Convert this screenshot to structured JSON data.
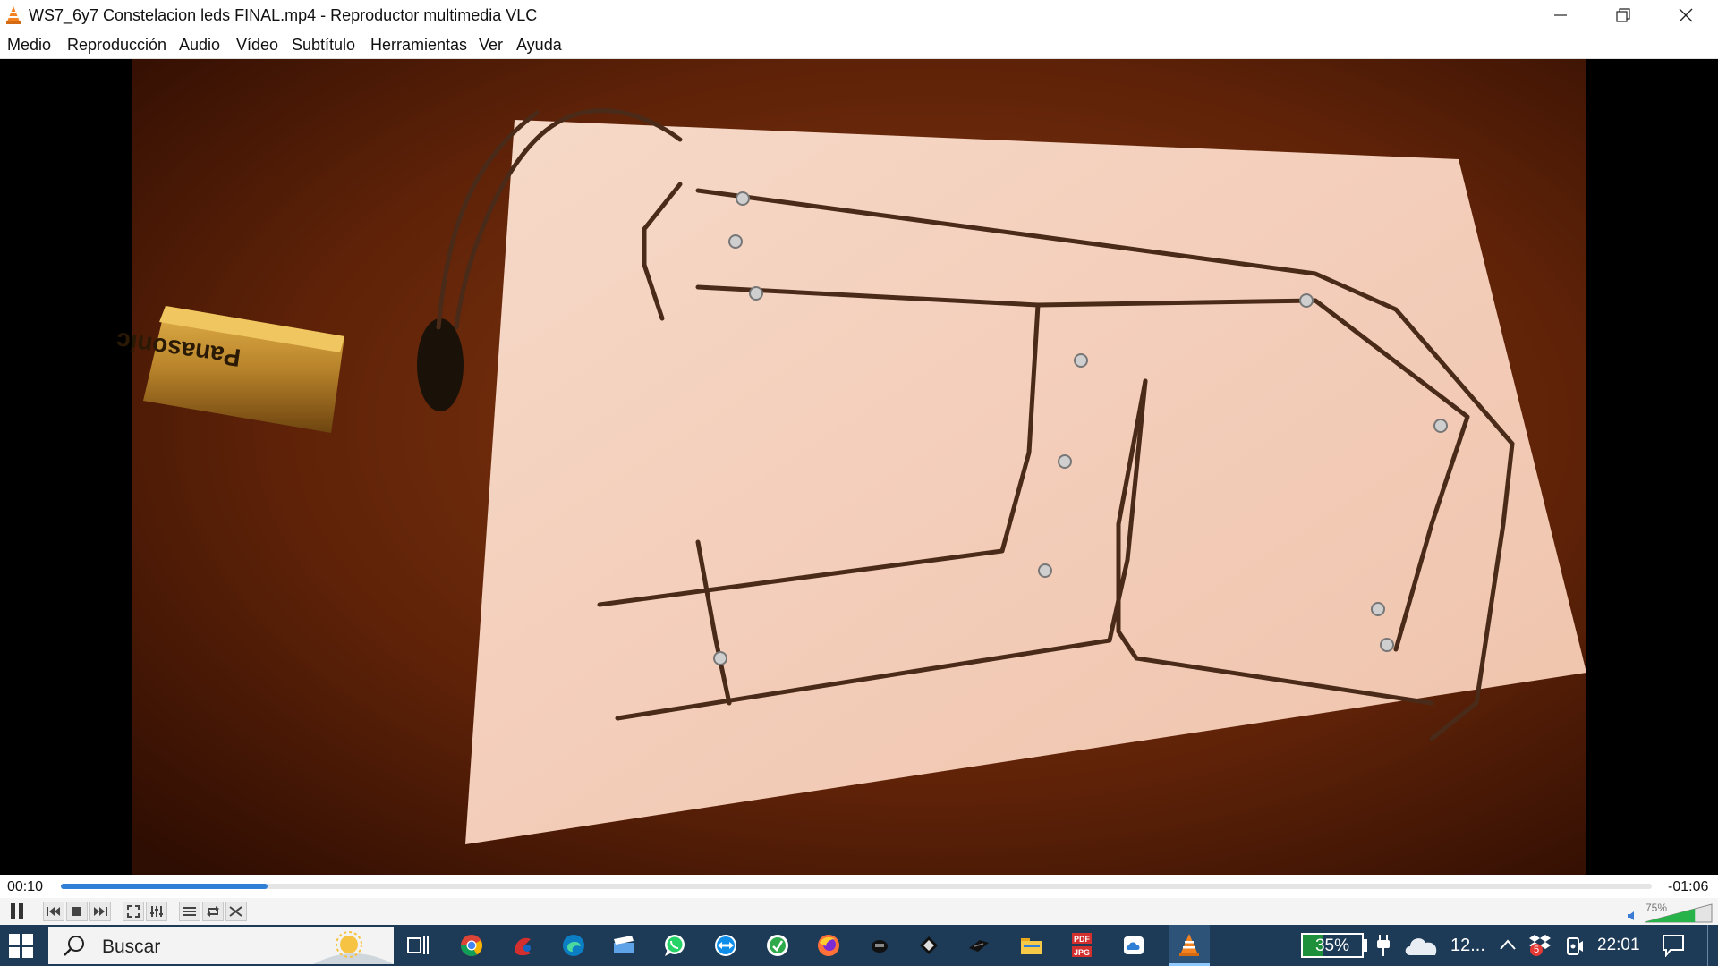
{
  "window": {
    "title": "WS7_6y7 Constelacion leds FINAL.mp4 - Reproductor multimedia VLC",
    "controls": [
      "minimize",
      "restore",
      "close"
    ]
  },
  "menu": {
    "items": [
      "Medio",
      "Reproducción",
      "Audio",
      "Vídeo",
      "Subtítulo",
      "Herramientas",
      "Ver",
      "Ayuda"
    ]
  },
  "video": {
    "battery_brand": "Panasonic"
  },
  "player": {
    "elapsed": "00:10",
    "remaining": "-01:06",
    "progress": 0.13,
    "volume_label": "75%",
    "volume": 0.75
  },
  "taskbar": {
    "search_placeholder": "Buscar",
    "apps": [
      "task-view",
      "chrome",
      "app-red",
      "edge",
      "app-blue",
      "whatsapp",
      "teamviewer",
      "app-green",
      "firefox",
      "app-dark-1",
      "app-dark-2",
      "app-dark-3",
      "file-explorer",
      "pdf-to-jpg",
      "app-cloud",
      "vlc"
    ],
    "pdf_icon_top": "PDF",
    "pdf_icon_bottom": "JPG",
    "battery_percent": "35%",
    "battery_level": 0.35,
    "weather_temp": "12...",
    "notif_badge": "5",
    "clock": "22:01"
  }
}
